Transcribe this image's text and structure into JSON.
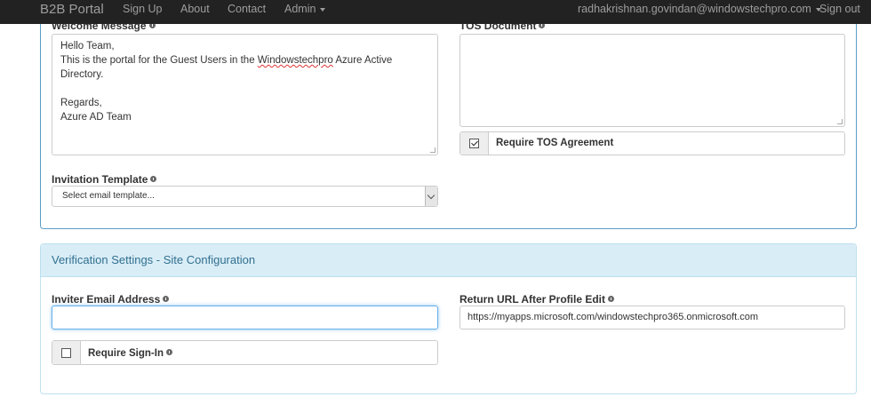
{
  "navbar": {
    "brand": "B2B Portal",
    "links": [
      "Sign Up",
      "About",
      "Contact"
    ],
    "admin": "Admin",
    "user": "radhakrishnan.govindan@windowstechpro.com",
    "signout": "Sign out"
  },
  "welcome": {
    "label": "Welcome Message",
    "line1": "Hello Team,",
    "line2a": "This is the portal for the Guest Users in the ",
    "line2b": "Windowstechpro",
    "line2c": " Azure Active",
    "line3": "Directory.",
    "line4": "Regards,",
    "line5": "Azure AD Team"
  },
  "tos": {
    "label": "TOS Document",
    "require_label": "Require TOS Agreement",
    "checked": true
  },
  "invitation": {
    "label": "Invitation Template",
    "placeholder": "Select email template..."
  },
  "verification": {
    "heading": "Verification Settings - Site Configuration",
    "inviter_label": "Inviter Email Address",
    "inviter_value": "",
    "return_label": "Return URL After Profile Edit",
    "return_value": "https://myapps.microsoft.com/windowstechpro365.onmicrosoft.com",
    "signin_label": "Require Sign-In",
    "signin_checked": false
  }
}
